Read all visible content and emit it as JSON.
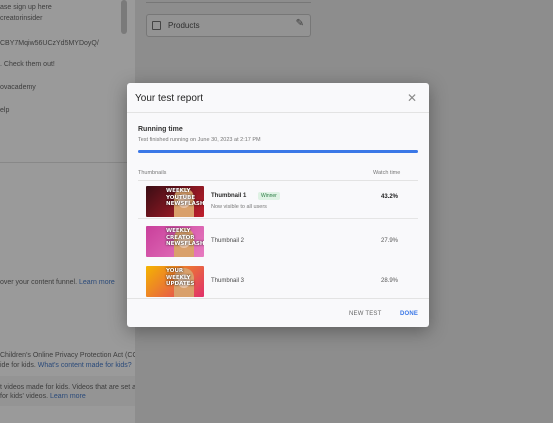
{
  "background": {
    "left_lines": [
      "ase sign up here",
      "creatorinsider",
      "CBY7Mqiw56UCzYd5MYDoyQ/",
      ". Check them out!",
      "ovacademy",
      "elp"
    ],
    "content_funnel_text": "over your content funnel.",
    "content_funnel_link": "Learn more",
    "coppa_line1": "Children's Online Privacy Protection Act (COPPA)",
    "coppa_line2": "ide for kids.",
    "coppa_link": "What's content made for kids?",
    "kids_line1": "t videos made for kids. Videos that are set as",
    "kids_line2": "for kids' videos.",
    "kids_link": "Learn more",
    "products_label": "Products"
  },
  "modal": {
    "title": "Your test report",
    "running_label": "Running time",
    "finished_text": "Test finished running on June 30, 2023 at 2:17 PM",
    "progress": 1.0,
    "col_thumbnails": "Thumbnails",
    "col_watch_time": "Watch time",
    "rows": [
      {
        "name": "Thumbnail 1",
        "badge": "Winner",
        "sub": "Now visible to all users",
        "value": "43.2%",
        "thumb_text": "WEEKLY YOUTUBE NEWSFLASH",
        "thumb_colors": [
          "#3a0d14",
          "#c01f2c"
        ]
      },
      {
        "name": "Thumbnail 2",
        "value": "27.9%",
        "thumb_text": "WEEKLY CREATOR NEWSFLASH",
        "thumb_colors": [
          "#c93f9b",
          "#e77bc0"
        ]
      },
      {
        "name": "Thumbnail 3",
        "value": "28.9%",
        "thumb_text": "YOUR WEEKLY UPDATES",
        "thumb_colors": [
          "#f4b400",
          "#e1306c"
        ]
      }
    ],
    "new_test_label": "NEW TEST",
    "done_label": "DONE"
  },
  "colors": {
    "accent": "#3b78e7",
    "winner_text": "#2d7d46",
    "winner_bg": "#dff2e4"
  }
}
